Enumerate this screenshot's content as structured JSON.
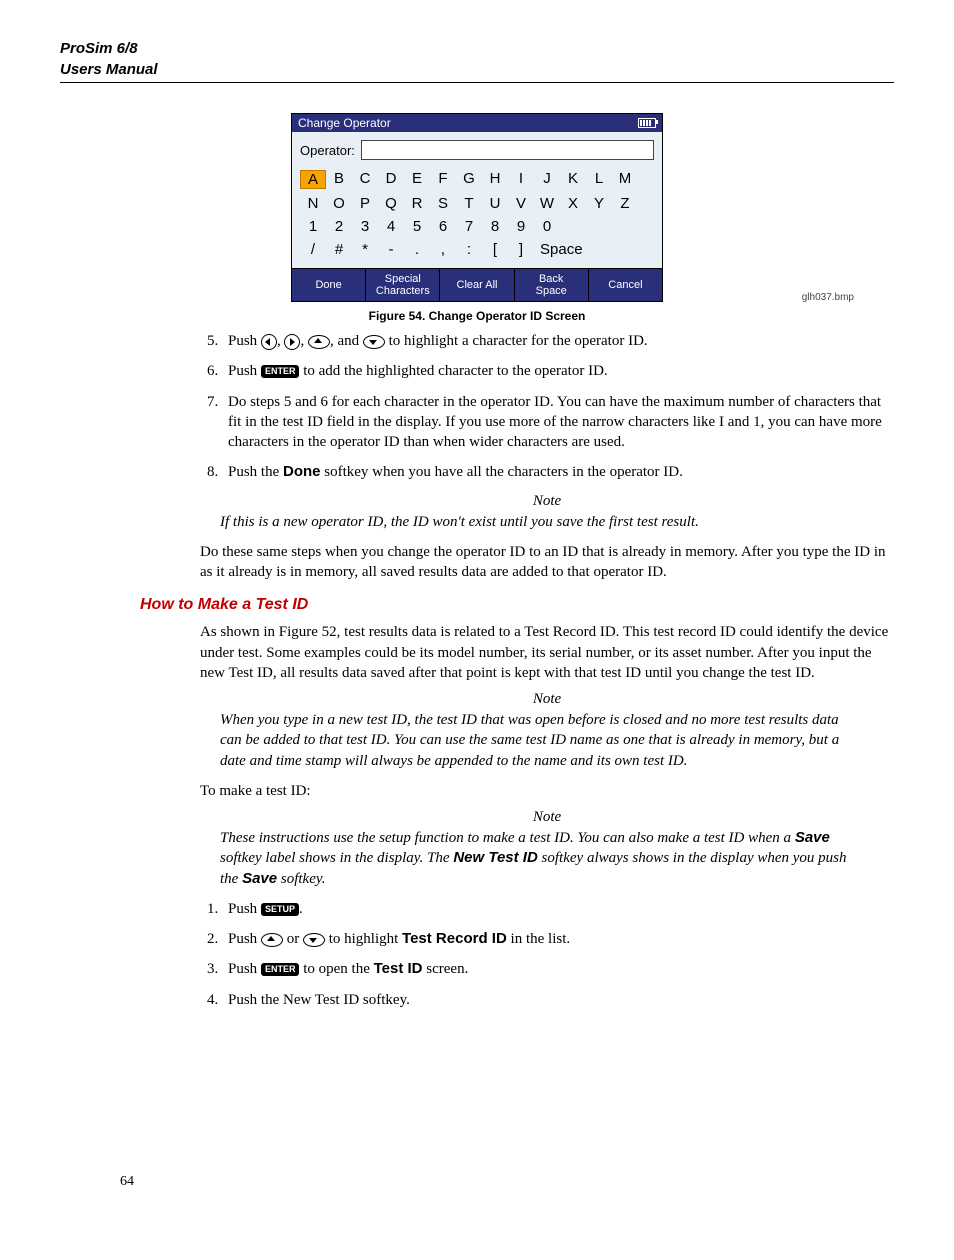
{
  "header": {
    "line1": "ProSim 6/8",
    "line2": "Users Manual"
  },
  "figure": {
    "title": "Change Operator",
    "operator_label": "Operator:",
    "rows": [
      [
        "A",
        "B",
        "C",
        "D",
        "E",
        "F",
        "G",
        "H",
        "I",
        "J",
        "K",
        "L",
        "M"
      ],
      [
        "N",
        "O",
        "P",
        "Q",
        "R",
        "S",
        "T",
        "U",
        "V",
        "W",
        "X",
        "Y",
        "Z"
      ],
      [
        "1",
        "2",
        "3",
        "4",
        "5",
        "6",
        "7",
        "8",
        "9",
        "0"
      ],
      [
        "/",
        "#",
        "*",
        "-",
        ".",
        ",",
        ":",
        "[",
        "]",
        "Space"
      ]
    ],
    "selected": "A",
    "softkeys": [
      "Done",
      "Special\nCharacters",
      "Clear All",
      "Back\nSpace",
      "Cancel"
    ],
    "caption": "Figure 54. Change Operator ID Screen",
    "filename": "glh037.bmp"
  },
  "steps_a": {
    "start": 5,
    "items": [
      {
        "pre": "Push ",
        "post": " to highlight a character for the operator ID.",
        "type": "nav4"
      },
      {
        "pre": "Push ",
        "key": "ENTER",
        "post": " to add the highlighted character to the operator ID."
      },
      {
        "text": "Do steps 5 and 6 for each character in the operator ID. You can have the maximum number of characters that fit in the test ID field in the display. If you use more of the narrow characters like I and 1, you can have more characters in the operator ID than when wider characters are used."
      },
      {
        "pre": "Push the ",
        "bold": "Done",
        "post": " softkey when you have all the characters in the operator ID."
      }
    ]
  },
  "note1": {
    "label": "Note",
    "body": "If this is a new operator ID, the ID won't exist until you save the first test result."
  },
  "para1": "Do these same steps when you change the operator ID to an ID that is already in memory. After you type the ID in as it already is in memory, all saved results data are added to that operator ID.",
  "section_heading": "How to Make a Test ID",
  "para2": "As shown in Figure 52, test results data is related to a Test Record ID. This test record ID could identify the device under test. Some examples could be its model number, its serial number, or its asset number. After you input the new Test ID, all results data saved after that point is kept with that test ID until you change the test ID.",
  "note2": {
    "label": "Note",
    "body": "When you type in a new test ID, the test ID that was open before is closed and no more test results data can be added to that test ID. You can use the same test ID name as one that is already in memory, but a date and time stamp will always be appended to the name and its own test ID."
  },
  "para3": "To make a test ID:",
  "note3": {
    "label": "Note",
    "pre": "These instructions use the setup function to make a test ID. You can also make a test ID when a ",
    "b1": "Save",
    "mid1": " softkey label shows in the display. The ",
    "b2": "New Test ID",
    "mid2": " softkey always shows in the display when you push the ",
    "b3": "Save",
    "post": " softkey."
  },
  "steps_b": {
    "start": 1,
    "items": [
      {
        "pre": "Push ",
        "key": "SETUP",
        "post": "."
      },
      {
        "pre": "Push ",
        "type": "updown",
        "mid": " to highlight ",
        "bold": "Test Record ID",
        "post": " in the list."
      },
      {
        "pre": "Push ",
        "key": "ENTER",
        "mid": " to open the ",
        "bold": "Test ID",
        "post": " screen."
      },
      {
        "text": "Push the New Test ID softkey."
      }
    ]
  },
  "page_number": "64"
}
